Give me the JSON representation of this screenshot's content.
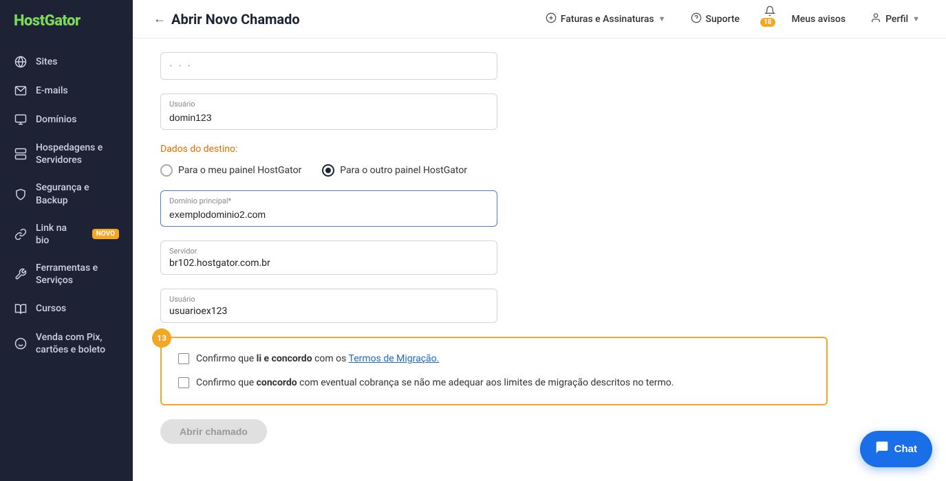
{
  "brand": {
    "name_part1": "Host",
    "name_part2": "Gator"
  },
  "sidebar": {
    "items": [
      {
        "id": "sites",
        "label": "Sites",
        "icon": "globe"
      },
      {
        "id": "emails",
        "label": "E-mails",
        "icon": "mail"
      },
      {
        "id": "dominios",
        "label": "Domínios",
        "icon": "domain"
      },
      {
        "id": "hospedagens",
        "label": "Hospedagens e Servidores",
        "icon": "server"
      },
      {
        "id": "seguranca",
        "label": "Segurança e Backup",
        "icon": "shield"
      },
      {
        "id": "link",
        "label": "Link na bio",
        "icon": "link",
        "badge": "NOVO"
      },
      {
        "id": "ferramentas",
        "label": "Ferramentas e Serviços",
        "icon": "tools"
      },
      {
        "id": "cursos",
        "label": "Cursos",
        "icon": "book"
      },
      {
        "id": "venda",
        "label": "Venda com Pix, cartões e boleto",
        "icon": "pix"
      }
    ]
  },
  "topnav": {
    "back_label": "←",
    "title": "Abrir Novo Chamado",
    "faturas_label": "Faturas e Assinaturas",
    "suporte_label": "Suporte",
    "avisos_label": "Meus avisos",
    "notif_count": "18",
    "perfil_label": "Perfil"
  },
  "form": {
    "usuario_origem_label": "Usuário",
    "usuario_origem_value": "domin123",
    "dados_destino_label": "Dados do destino:",
    "radio_meu_painel": "Para o meu painel HostGator",
    "radio_outro_painel": "Para o outro painel HostGator",
    "dominio_label": "Domínio principal*",
    "dominio_value": "exemplodominio2.com",
    "servidor_label": "Servidor",
    "servidor_value": "br102.hostgator.com.br",
    "usuario_destino_label": "Usuário",
    "usuario_destino_value": "usuarioex123",
    "step_number": "13",
    "checkbox1_text_prefix": "Confirmo que ",
    "checkbox1_bold1": "li e concordo",
    "checkbox1_text_mid": " com os ",
    "checkbox1_link": "Termos de Migração.",
    "checkbox2_text_prefix": "Confirmo que ",
    "checkbox2_bold": "concordo",
    "checkbox2_text_suffix": " com eventual cobrança se não me adequar aos limites de migração descritos no termo.",
    "submit_label": "Abrir chamado"
  },
  "chat": {
    "label": "Chat",
    "icon": "chat-bubble"
  }
}
